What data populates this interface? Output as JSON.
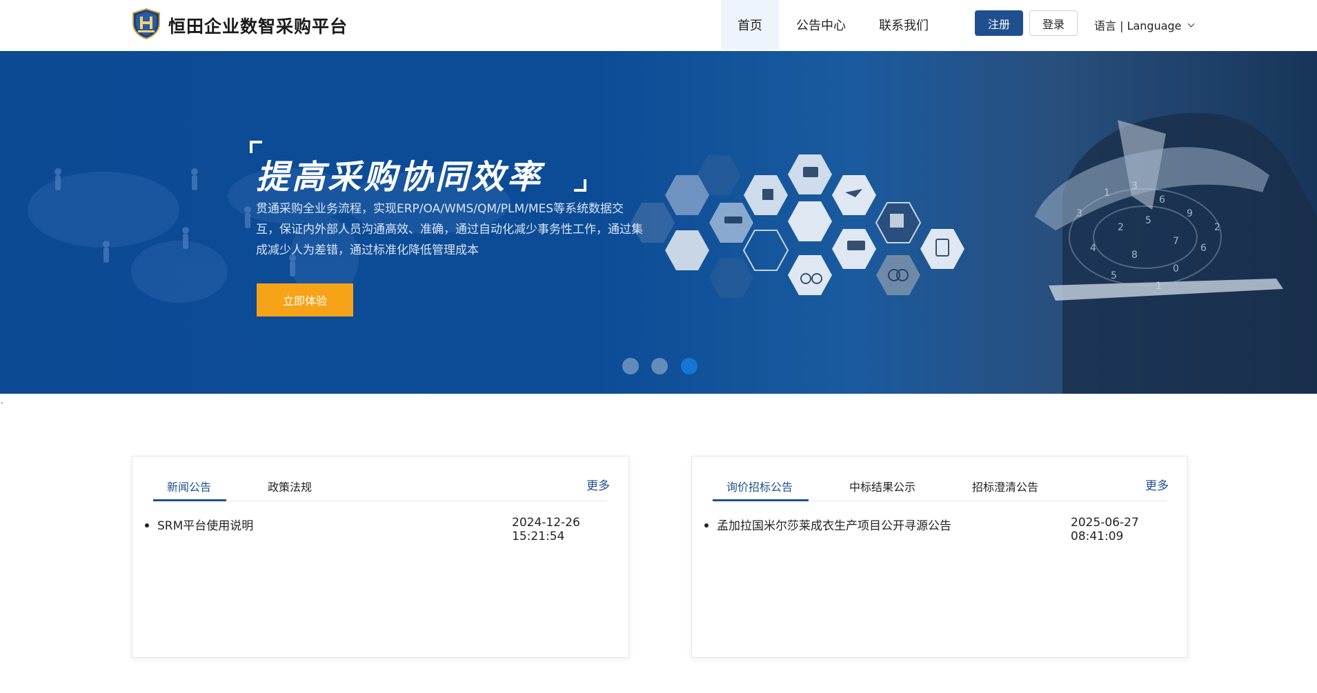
{
  "header": {
    "brand": "恒田企业数智采购平台",
    "nav": [
      "首页",
      "公告中心",
      "联系我们"
    ],
    "register_label": "注册",
    "login_label": "登录",
    "language_label": "语言 | Language"
  },
  "banner": {
    "headline": "提高采购协同效率",
    "description": "贯通采购全业务流程，实现ERP/OA/WMS/QM/PLM/MES等系统数据交互，保证内外部人员沟通高效、准确，通过自动化减少事务性工作，通过集成减少人为差错，通过标准化降低管理成本",
    "cta_label": "立即体验",
    "active_slide": 3,
    "slide_count": 3
  },
  "stray_mark": ".",
  "news_card": {
    "tabs": [
      "新闻公告",
      "政策法规"
    ],
    "active_tab": 0,
    "more_label": "更多",
    "items": [
      {
        "title": "SRM平台使用说明",
        "date": "2024-12-26 15:21:54"
      }
    ]
  },
  "bid_card": {
    "tabs": [
      "询价招标公告",
      "中标结果公示",
      "招标澄清公告"
    ],
    "active_tab": 0,
    "more_label": "更多",
    "items": [
      {
        "title": "孟加拉国米尔莎莱成衣生产项目公开寻源公告",
        "date": "2025-06-27 08:41:09"
      }
    ]
  },
  "colors": {
    "primary": "#1f4f8f",
    "banner_blue": "#0c4c97",
    "cta_orange": "#f6a318",
    "active_dot": "#1577d3"
  }
}
